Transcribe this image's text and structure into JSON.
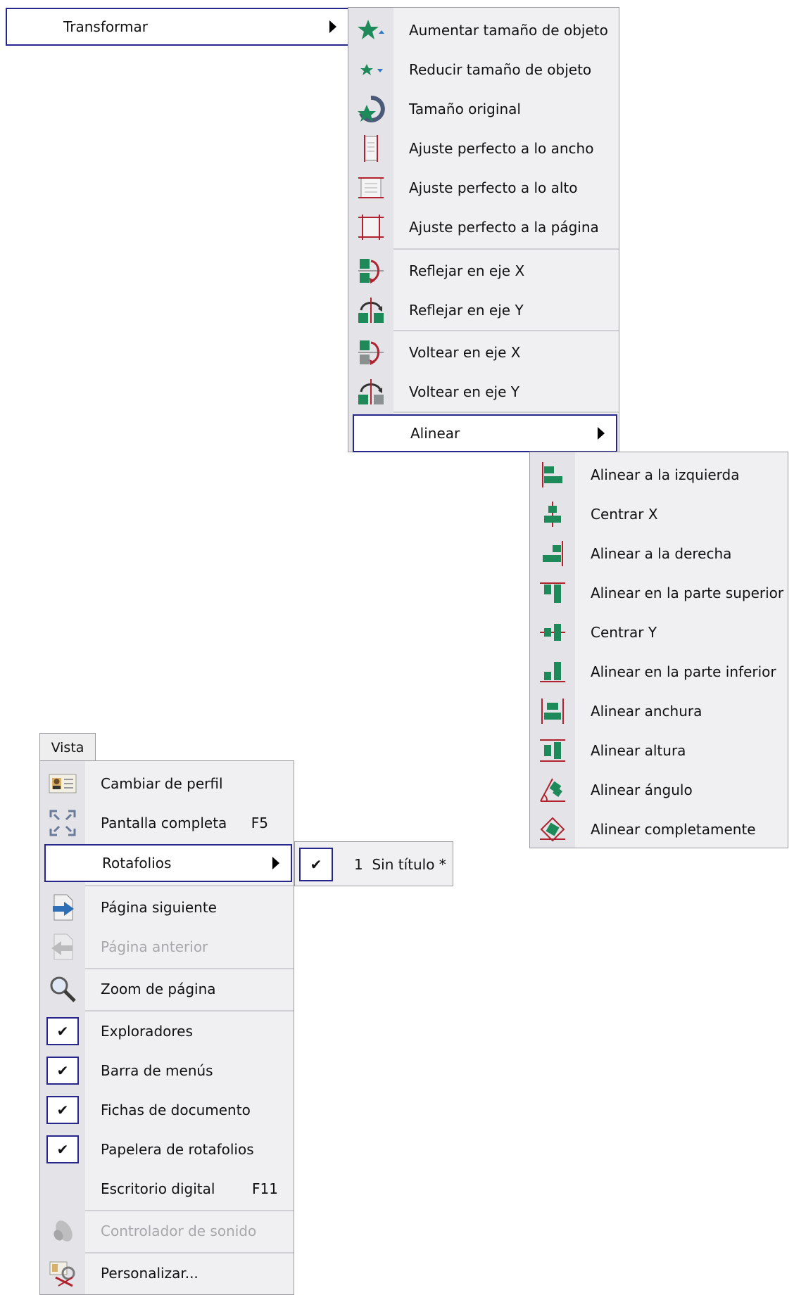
{
  "top_item": {
    "label": "Transformar"
  },
  "transform_menu": {
    "items": [
      {
        "label": "Aumentar tamaño de objeto",
        "icon": "star-grow-icon"
      },
      {
        "label": "Reducir tamaño de objeto",
        "icon": "star-shrink-icon"
      },
      {
        "label": "Tamaño original",
        "icon": "star-reset-icon"
      },
      {
        "label": "Ajuste perfecto a lo ancho",
        "icon": "fit-width-icon"
      },
      {
        "label": "Ajuste perfecto a lo alto",
        "icon": "fit-height-icon"
      },
      {
        "label": "Ajuste perfecto a la página",
        "icon": "fit-page-icon"
      },
      {
        "label": "Reflejar en eje X",
        "icon": "mirror-x-icon"
      },
      {
        "label": "Reflejar en eje Y",
        "icon": "mirror-y-icon"
      },
      {
        "label": "Voltear en eje X",
        "icon": "flip-x-icon"
      },
      {
        "label": "Voltear en eje Y",
        "icon": "flip-y-icon"
      }
    ],
    "submenu_label": "Alinear"
  },
  "align_menu": {
    "items": [
      {
        "label": "Alinear a la izquierda",
        "icon": "align-left-icon"
      },
      {
        "label": "Centrar X",
        "icon": "center-x-icon"
      },
      {
        "label": "Alinear a la derecha",
        "icon": "align-right-icon"
      },
      {
        "label": "Alinear en la parte superior",
        "icon": "align-top-icon"
      },
      {
        "label": "Centrar Y",
        "icon": "center-y-icon"
      },
      {
        "label": "Alinear en la parte inferior",
        "icon": "align-bottom-icon"
      },
      {
        "label": "Alinear anchura",
        "icon": "align-width-icon"
      },
      {
        "label": "Alinear altura",
        "icon": "align-height-icon"
      },
      {
        "label": "Alinear ángulo",
        "icon": "align-angle-icon"
      },
      {
        "label": "Alinear completamente",
        "icon": "align-full-icon"
      }
    ]
  },
  "vista_menu": {
    "tab_label": "Vista",
    "items": {
      "profile": {
        "label": "Cambiar de perfil",
        "icon": "profile-card-icon"
      },
      "fullscreen": {
        "label": "Pantalla completa",
        "shortcut": "F5",
        "icon": "fullscreen-icon"
      },
      "flipcharts": {
        "label": "Rotafolios"
      },
      "next_page": {
        "label": "Página siguiente",
        "icon": "next-page-icon"
      },
      "prev_page": {
        "label": "Página anterior",
        "icon": "previous-page-icon",
        "disabled": true
      },
      "zoom": {
        "label": "Zoom de página",
        "icon": "magnifier-icon"
      },
      "explorers": {
        "label": "Exploradores",
        "checked": true
      },
      "menubar": {
        "label": "Barra de menús",
        "checked": true
      },
      "doc_tabs": {
        "label": "Fichas de documento",
        "checked": true
      },
      "trash": {
        "label": "Papelera de rotafolios",
        "checked": true
      },
      "desktop": {
        "label": "Escritorio digital",
        "shortcut": "F11"
      },
      "sound": {
        "label": "Controlador de sonido",
        "icon": "speaker-icon",
        "disabled": true
      },
      "customize": {
        "label": "Personalizar...",
        "icon": "customize-icon"
      }
    },
    "check_glyph": "✔"
  },
  "flipchart_submenu": {
    "items": [
      {
        "label": "1  Sin título *",
        "checked": true
      }
    ]
  },
  "colors": {
    "highlight_border": "#26268c",
    "icon_green": "#1e8a5a",
    "icon_red": "#b0222e"
  }
}
